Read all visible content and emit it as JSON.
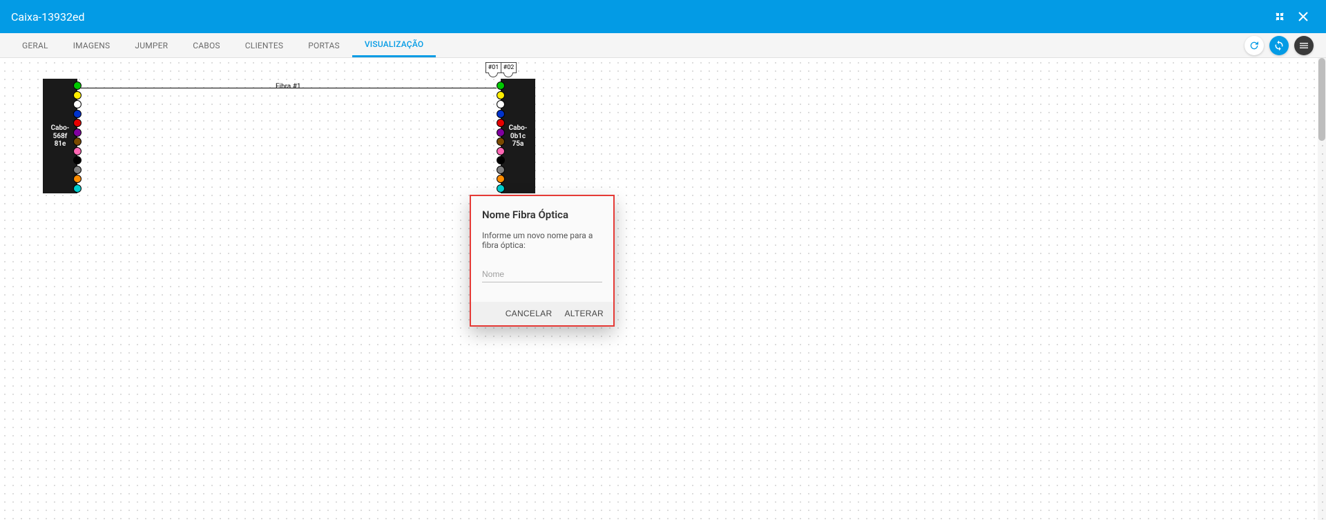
{
  "titlebar": {
    "title": "Caixa-13932ed"
  },
  "tabs": {
    "items": [
      {
        "label": "GERAL"
      },
      {
        "label": "IMAGENS"
      },
      {
        "label": "JUMPER"
      },
      {
        "label": "CABOS"
      },
      {
        "label": "CLIENTES"
      },
      {
        "label": "PORTAS"
      },
      {
        "label": "VISUALIZAÇÃO",
        "active": true
      }
    ]
  },
  "diagram": {
    "left_box": {
      "line1": "Cabo-568f",
      "line2": "81e"
    },
    "right_box": {
      "line1": "Cabo-0b1c",
      "line2": "75a"
    },
    "link_label": "Fibra #1",
    "port_tabs": [
      "#01",
      "#02"
    ],
    "port_colors": [
      "green",
      "yellow",
      "white",
      "blue",
      "red",
      "violet",
      "brown",
      "pink",
      "black",
      "grey",
      "orange",
      "aqua"
    ]
  },
  "dialog": {
    "title": "Nome Fibra Óptica",
    "message": "Informe um novo nome para a fibra óptica:",
    "placeholder": "Nome",
    "cancel": "CANCELAR",
    "confirm": "ALTERAR"
  }
}
